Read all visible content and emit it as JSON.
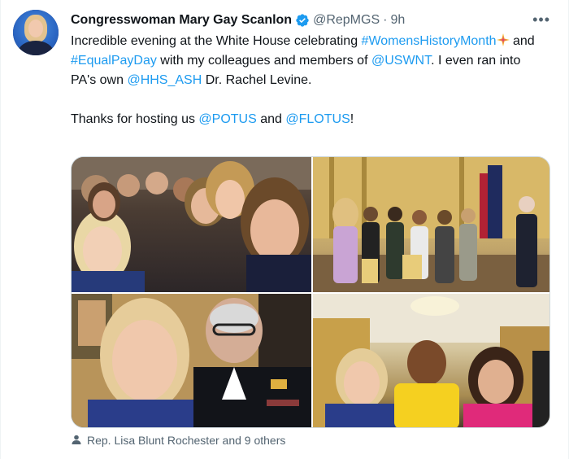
{
  "tweet": {
    "display_name": "Congresswoman Mary Gay Scanlon",
    "handle": "@RepMGS",
    "separator": "·",
    "time": "9h",
    "more_label": "•••",
    "text": {
      "line1_pre": "Incredible evening at the White House celebrating ",
      "hashtag1": "#WomensHistoryMonth",
      "mid1": " and ",
      "hashtag2": "#EqualPayDay",
      "mid2": " with my colleagues and members of ",
      "mention1": "@USWNT",
      "mid3": ". I even ran into PA's own ",
      "mention2": "@HHS_ASH",
      "end1": " Dr. Rachel Levine.",
      "p2_pre": "Thanks for hosting us ",
      "mention3": "@POTUS",
      "p2_mid": " and ",
      "mention4": "@FLOTUS",
      "p2_end": "!"
    },
    "tagged_people": "Rep. Lisa Blunt Rochester and 9 others"
  },
  "icons": {
    "verified": "verified-badge-icon",
    "more": "more-options-icon",
    "sparkle": "sparkle-emoji-icon",
    "person": "tagged-person-icon"
  },
  "colors": {
    "link": "#1d9bf0",
    "secondary": "#536471",
    "primary_text": "#0f1419"
  }
}
